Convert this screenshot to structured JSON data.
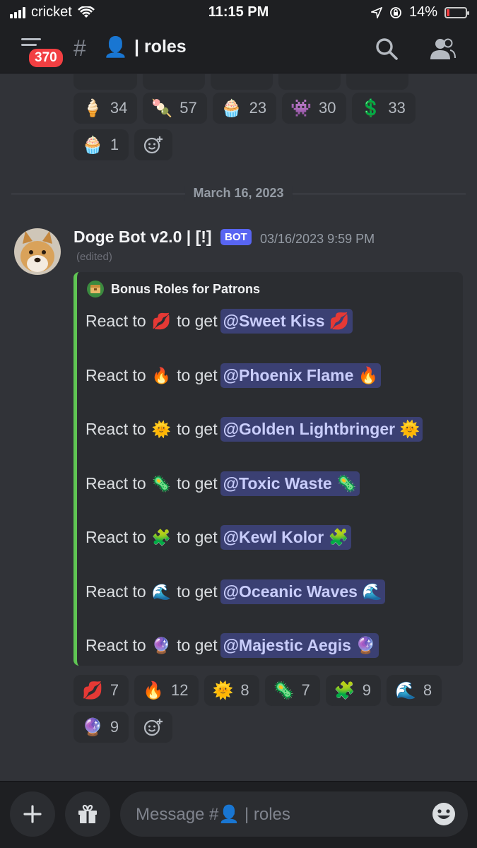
{
  "status_bar": {
    "carrier": "cricket",
    "time": "11:15 PM",
    "battery": "14%",
    "battery_level": 0.14
  },
  "header": {
    "notification_badge": "370",
    "channel_emoji": "👤",
    "channel_name": "| roles"
  },
  "top_reactions": [
    {
      "emoji": "🍦",
      "count": "34"
    },
    {
      "emoji": "🍡",
      "count": "57"
    },
    {
      "emoji": "🧁",
      "count": "23"
    },
    {
      "emoji": "👾",
      "count": "30"
    },
    {
      "emoji": "💲",
      "count": "33"
    },
    {
      "emoji": "🧁",
      "count": "1"
    }
  ],
  "date_divider": "March 16, 2023",
  "message": {
    "author": "Doge Bot v2.0 | [!]",
    "bot_tag": "BOT",
    "timestamp": "03/16/2023 9:59 PM",
    "edited": "(edited)",
    "embed": {
      "title": "Bonus Roles for Patrons",
      "react_to": "React to",
      "to_get": "to get",
      "roles": [
        {
          "emoji": "💋",
          "role": "@Sweet Kiss 💋"
        },
        {
          "emoji": "🔥",
          "role": "@Phoenix Flame 🔥"
        },
        {
          "emoji": "🌞",
          "role": "@Golden Lightbringer 🌞"
        },
        {
          "emoji": "🦠",
          "role": "@Toxic Waste 🦠"
        },
        {
          "emoji": "🧩",
          "role": "@Kewl Kolor 🧩"
        },
        {
          "emoji": "🌊",
          "role": "@Oceanic Waves 🌊"
        },
        {
          "emoji": "🔮",
          "role": "@Majestic Aegis 🔮"
        }
      ]
    },
    "reactions": [
      {
        "emoji": "💋",
        "count": "7"
      },
      {
        "emoji": "🔥",
        "count": "12"
      },
      {
        "emoji": "🌞",
        "count": "8"
      },
      {
        "emoji": "🦠",
        "count": "7"
      },
      {
        "emoji": "🧩",
        "count": "9"
      },
      {
        "emoji": "🌊",
        "count": "8"
      },
      {
        "emoji": "🔮",
        "count": "9"
      }
    ]
  },
  "composer": {
    "placeholder_prefix": "Message #",
    "placeholder_emoji": "👤",
    "placeholder_suffix": "| roles"
  }
}
